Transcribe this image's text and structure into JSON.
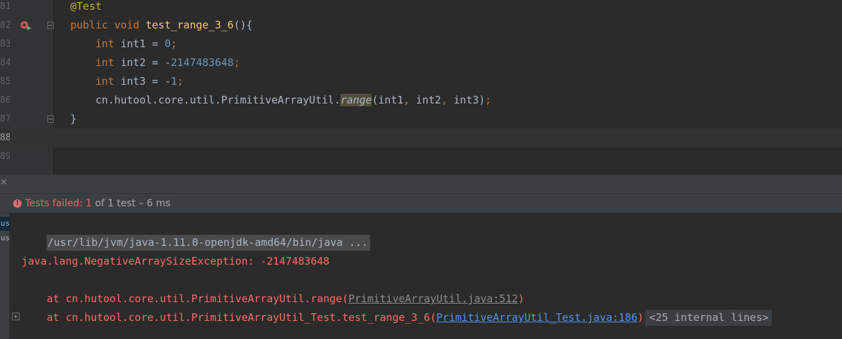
{
  "editor": {
    "lines": [
      {
        "num": "81",
        "code": [
          [
            "ann",
            "@Test"
          ]
        ]
      },
      {
        "num": "82",
        "code": [
          [
            "kw",
            "public void "
          ],
          [
            "fn",
            "test_range_3_6"
          ],
          [
            "p",
            "(){"
          ]
        ]
      },
      {
        "num": "83",
        "code": [
          [
            "p",
            "    "
          ],
          [
            "kw",
            "int "
          ],
          [
            "p",
            "int1 = "
          ],
          [
            "num",
            "0"
          ],
          [
            "kw",
            ";"
          ]
        ]
      },
      {
        "num": "84",
        "code": [
          [
            "p",
            "    "
          ],
          [
            "kw",
            "int "
          ],
          [
            "p",
            "int2 = -"
          ],
          [
            "num",
            "2147483648"
          ],
          [
            "kw",
            ";"
          ]
        ]
      },
      {
        "num": "85",
        "code": [
          [
            "p",
            "    "
          ],
          [
            "kw",
            "int "
          ],
          [
            "p",
            "int3 = -"
          ],
          [
            "num",
            "1"
          ],
          [
            "kw",
            ";"
          ]
        ]
      },
      {
        "num": "86",
        "code": [
          [
            "p",
            "    cn.hutool.core.util.PrimitiveArrayUtil."
          ],
          [
            "hl",
            "range"
          ],
          [
            "p",
            "(int1"
          ],
          [
            "kw",
            ", "
          ],
          [
            "p",
            "int2"
          ],
          [
            "kw",
            ", "
          ],
          [
            "p",
            "int3)"
          ],
          [
            "kw",
            ";"
          ]
        ]
      },
      {
        "num": "87",
        "code": [
          [
            "p",
            "}"
          ]
        ]
      },
      {
        "num": "88",
        "code": []
      },
      {
        "num": "89",
        "code": []
      }
    ],
    "current_line": "88",
    "gutter_icon": "run-test-breakpoint-icon"
  },
  "run_panel": {
    "close_glyph": "×",
    "status": {
      "failed_label": "Tests failed: ",
      "failed_count": "1",
      "rest": " of 1 test – 6 ms"
    },
    "left_tabs": [
      "us",
      "us"
    ],
    "console": {
      "command": "/usr/lib/jvm/java-1.11.0-openjdk-amd64/bin/java ...",
      "exception": "java.lang.NegativeArraySizeException: -2147483648",
      "frame1_prefix": "    at cn.hutool.core.util.PrimitiveArrayUtil.range(",
      "frame1_link": "PrimitiveArrayUtil.java:512",
      "frame1_suffix": ")",
      "frame2_prefix": "    at cn.hutool.core.util.PrimitiveArrayUtil_Test.test_range_3_6(",
      "frame2_link": "PrimitiveArrayUtil_Test.java:186",
      "frame2_suffix": ")",
      "internal_lines": "<25 internal lines>"
    }
  },
  "colors": {
    "error": "#ff6b68",
    "link": "#5394ec",
    "keyword": "#cc7832",
    "annotation": "#bbb529"
  }
}
